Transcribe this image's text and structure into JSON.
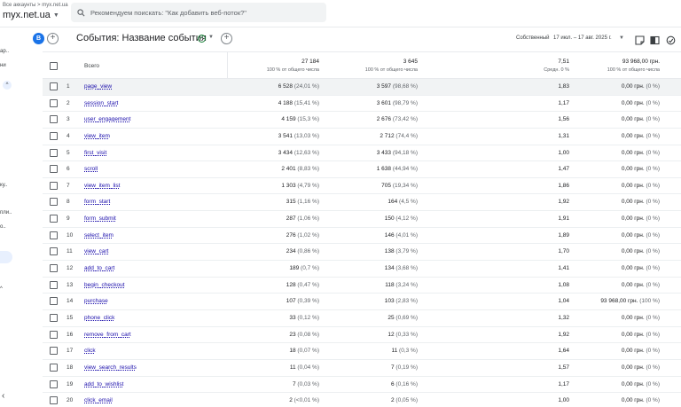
{
  "header": {
    "breadcrumb": "Все аккаунты > myx.net.ua",
    "property_name": "myx.net.ua",
    "search_placeholder": "Рекомендуем поискать: \"Как добавить веб-поток?\""
  },
  "leftnav": {
    "fragments": [
      "ар..",
      "ни",
      "^",
      "ку..",
      "пли..",
      "о..",
      "^"
    ]
  },
  "toolbar": {
    "compare_badge": "B",
    "report_title": "События: Название события",
    "date_label": "Собственный",
    "date_range": "17 июл. – 17 авг. 2025 г."
  },
  "table": {
    "header_label": "Всего",
    "totals": [
      {
        "value": "27 184",
        "sub": "100 % от общего числа"
      },
      {
        "value": "3 645",
        "sub": "100 % от общего числа"
      },
      {
        "value": "7,51",
        "sub": "Средн. 0 %"
      },
      {
        "value": "93 968,00 грн.",
        "sub": "100 % от общего числа"
      }
    ],
    "rows": [
      {
        "n": "1",
        "event": "page_view",
        "v1": "6 528",
        "p1": "(24,01 %)",
        "v2": "3 597",
        "p2": "(98,68 %)",
        "v3": "1,83",
        "v4": "0,00 грн.",
        "p4": "(0 %)"
      },
      {
        "n": "2",
        "event": "session_start",
        "v1": "4 188",
        "p1": "(15,41 %)",
        "v2": "3 601",
        "p2": "(98,79 %)",
        "v3": "1,17",
        "v4": "0,00 грн.",
        "p4": "(0 %)"
      },
      {
        "n": "3",
        "event": "user_engagement",
        "v1": "4 159",
        "p1": "(15,3 %)",
        "v2": "2 676",
        "p2": "(73,42 %)",
        "v3": "1,56",
        "v4": "0,00 грн.",
        "p4": "(0 %)"
      },
      {
        "n": "4",
        "event": "view_item",
        "v1": "3 541",
        "p1": "(13,03 %)",
        "v2": "2 712",
        "p2": "(74,4 %)",
        "v3": "1,31",
        "v4": "0,00 грн.",
        "p4": "(0 %)"
      },
      {
        "n": "5",
        "event": "first_visit",
        "v1": "3 434",
        "p1": "(12,63 %)",
        "v2": "3 433",
        "p2": "(94,18 %)",
        "v3": "1,00",
        "v4": "0,00 грн.",
        "p4": "(0 %)"
      },
      {
        "n": "6",
        "event": "scroll",
        "v1": "2 401",
        "p1": "(8,83 %)",
        "v2": "1 638",
        "p2": "(44,94 %)",
        "v3": "1,47",
        "v4": "0,00 грн.",
        "p4": "(0 %)"
      },
      {
        "n": "7",
        "event": "view_item_list",
        "v1": "1 303",
        "p1": "(4,79 %)",
        "v2": "705",
        "p2": "(19,34 %)",
        "v3": "1,86",
        "v4": "0,00 грн.",
        "p4": "(0 %)"
      },
      {
        "n": "8",
        "event": "form_start",
        "v1": "315",
        "p1": "(1,16 %)",
        "v2": "164",
        "p2": "(4,5 %)",
        "v3": "1,92",
        "v4": "0,00 грн.",
        "p4": "(0 %)"
      },
      {
        "n": "9",
        "event": "form_submit",
        "v1": "287",
        "p1": "(1,06 %)",
        "v2": "150",
        "p2": "(4,12 %)",
        "v3": "1,91",
        "v4": "0,00 грн.",
        "p4": "(0 %)"
      },
      {
        "n": "10",
        "event": "select_item",
        "v1": "276",
        "p1": "(1,02 %)",
        "v2": "146",
        "p2": "(4,01 %)",
        "v3": "1,89",
        "v4": "0,00 грн.",
        "p4": "(0 %)"
      },
      {
        "n": "11",
        "event": "view_cart",
        "v1": "234",
        "p1": "(0,86 %)",
        "v2": "138",
        "p2": "(3,79 %)",
        "v3": "1,70",
        "v4": "0,00 грн.",
        "p4": "(0 %)"
      },
      {
        "n": "12",
        "event": "add_to_cart",
        "v1": "189",
        "p1": "(0,7 %)",
        "v2": "134",
        "p2": "(3,68 %)",
        "v3": "1,41",
        "v4": "0,00 грн.",
        "p4": "(0 %)"
      },
      {
        "n": "13",
        "event": "begin_checkout",
        "v1": "128",
        "p1": "(0,47 %)",
        "v2": "118",
        "p2": "(3,24 %)",
        "v3": "1,08",
        "v4": "0,00 грн.",
        "p4": "(0 %)"
      },
      {
        "n": "14",
        "event": "purchase",
        "v1": "107",
        "p1": "(0,39 %)",
        "v2": "103",
        "p2": "(2,83 %)",
        "v3": "1,04",
        "v4": "93 968,00 грн.",
        "p4": "(100 %)"
      },
      {
        "n": "15",
        "event": "phone_click",
        "v1": "33",
        "p1": "(0,12 %)",
        "v2": "25",
        "p2": "(0,69 %)",
        "v3": "1,32",
        "v4": "0,00 грн.",
        "p4": "(0 %)"
      },
      {
        "n": "16",
        "event": "remove_from_cart",
        "v1": "23",
        "p1": "(0,08 %)",
        "v2": "12",
        "p2": "(0,33 %)",
        "v3": "1,92",
        "v4": "0,00 грн.",
        "p4": "(0 %)"
      },
      {
        "n": "17",
        "event": "click",
        "v1": "18",
        "p1": "(0,07 %)",
        "v2": "11",
        "p2": "(0,3 %)",
        "v3": "1,64",
        "v4": "0,00 грн.",
        "p4": "(0 %)"
      },
      {
        "n": "18",
        "event": "view_search_results",
        "v1": "11",
        "p1": "(0,04 %)",
        "v2": "7",
        "p2": "(0,19 %)",
        "v3": "1,57",
        "v4": "0,00 грн.",
        "p4": "(0 %)"
      },
      {
        "n": "19",
        "event": "add_to_wishlist",
        "v1": "7",
        "p1": "(0,03 %)",
        "v2": "6",
        "p2": "(0,16 %)",
        "v3": "1,17",
        "v4": "0,00 грн.",
        "p4": "(0 %)"
      },
      {
        "n": "20",
        "event": "click_email",
        "v1": "2",
        "p1": "(<0,01 %)",
        "v2": "2",
        "p2": "(0,05 %)",
        "v3": "1,00",
        "v4": "0,00 грн.",
        "p4": "(0 %)"
      }
    ]
  },
  "colors": {
    "accent": "#1a73e8",
    "link": "#1a0dab",
    "ok": "#188038"
  }
}
